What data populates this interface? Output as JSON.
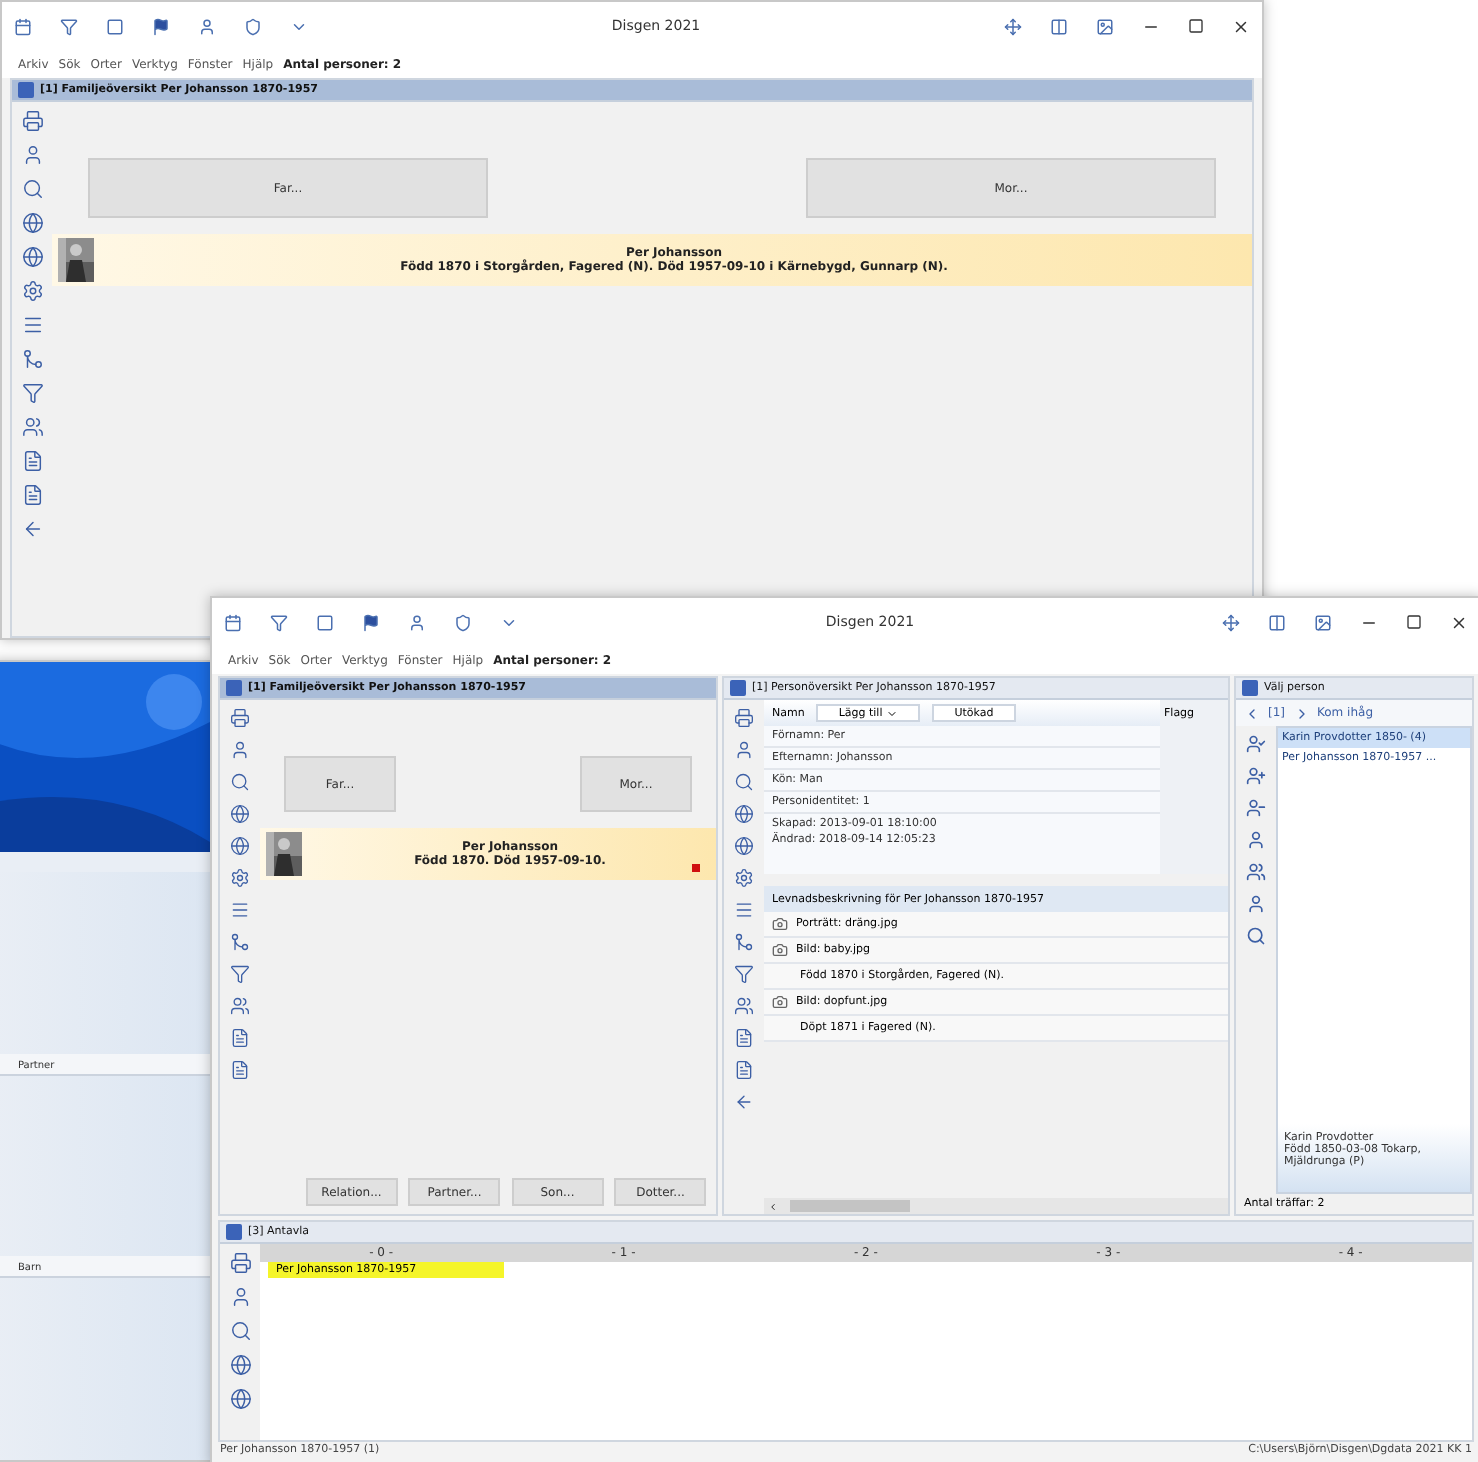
{
  "background_window": {
    "title": "Disgen 2021",
    "menu": [
      "Arkiv",
      "Sök",
      "Orter",
      "Verktyg",
      "Fönster",
      "Hjälp"
    ],
    "person_count": "Antal personer: 2",
    "panel_title": "[1] Familjeöversikt Per Johansson 1870-1957",
    "father_button": "Far...",
    "mother_button": "Mor...",
    "person_name": "Per Johansson",
    "person_details": "Född 1870 i Storgården, Fagered (N). Död 1957-09-10 i Kärnebygd, Gunnarp (N)."
  },
  "side_window": {
    "sections": [
      "Partner",
      "Barn"
    ]
  },
  "main_window": {
    "title": "Disgen 2021",
    "menu": [
      "Arkiv",
      "Sök",
      "Orter",
      "Verktyg",
      "Fönster",
      "Hjälp"
    ],
    "person_count": "Antal personer: 2",
    "family_panel": {
      "title": "[1] Familjeöversikt Per Johansson 1870-1957",
      "father_button": "Far...",
      "mother_button": "Mor...",
      "person_name": "Per Johansson",
      "person_details": "Född 1870. Död 1957-09-10.",
      "buttons": [
        "Relation...",
        "Partner...",
        "Son...",
        "Dotter..."
      ]
    },
    "overview_panel": {
      "title": "[1] Personöversikt Per Johansson 1870-1957",
      "name_label": "Namn",
      "add_button": "Lägg till",
      "mode_button": "Utökad",
      "flag_label": "Flagg",
      "name_rows": [
        "Förnamn: Per",
        "Efternamn: Johansson",
        "Kön: Man",
        "Personidentitet: 1"
      ],
      "created": "Skapad:  2013-09-01 18:10:00",
      "changed": "Ändrad:  2018-09-14 12:05:23",
      "biography_title": "Levnadsbeskrivning för Per Johansson 1870-1957",
      "biography": [
        {
          "text": "Porträtt: dräng.jpg"
        },
        {
          "text": "Bild: baby.jpg"
        },
        {
          "kind": "event",
          "text": "Född 1870 i Storgården, Fagered (N)."
        },
        {
          "text": "Bild: dopfunt.jpg"
        },
        {
          "kind": "event",
          "text": "Döpt 1871 i Fagered (N)."
        }
      ]
    },
    "select_panel": {
      "title": "Välj person",
      "history": "[1]",
      "remember": "Kom ihåg",
      "results": [
        {
          "text": "Karin Provdotter 1850- (4)",
          "selected": true
        },
        {
          "text": "Per Johansson 1870-1957 ...",
          "selected": false
        }
      ],
      "details": [
        "Karin Provdotter",
        "Född 1850-03-08 Tokarp,",
        "Mjäldrunga (P)"
      ],
      "hit_count": "Antal träffar: 2"
    },
    "pedigree_panel": {
      "title": "[3] Antavla",
      "generations": [
        "- 0 -",
        "- 1 -",
        "- 2 -",
        "- 3 -",
        "- 4 -"
      ],
      "person": "Per Johansson 1870-1957"
    },
    "status_bar": {
      "left": "Per Johansson 1870-1957 (1)",
      "right": "C:\\Users\\Björn\\Disgen\\Dgdata 2021 KK 1"
    }
  }
}
